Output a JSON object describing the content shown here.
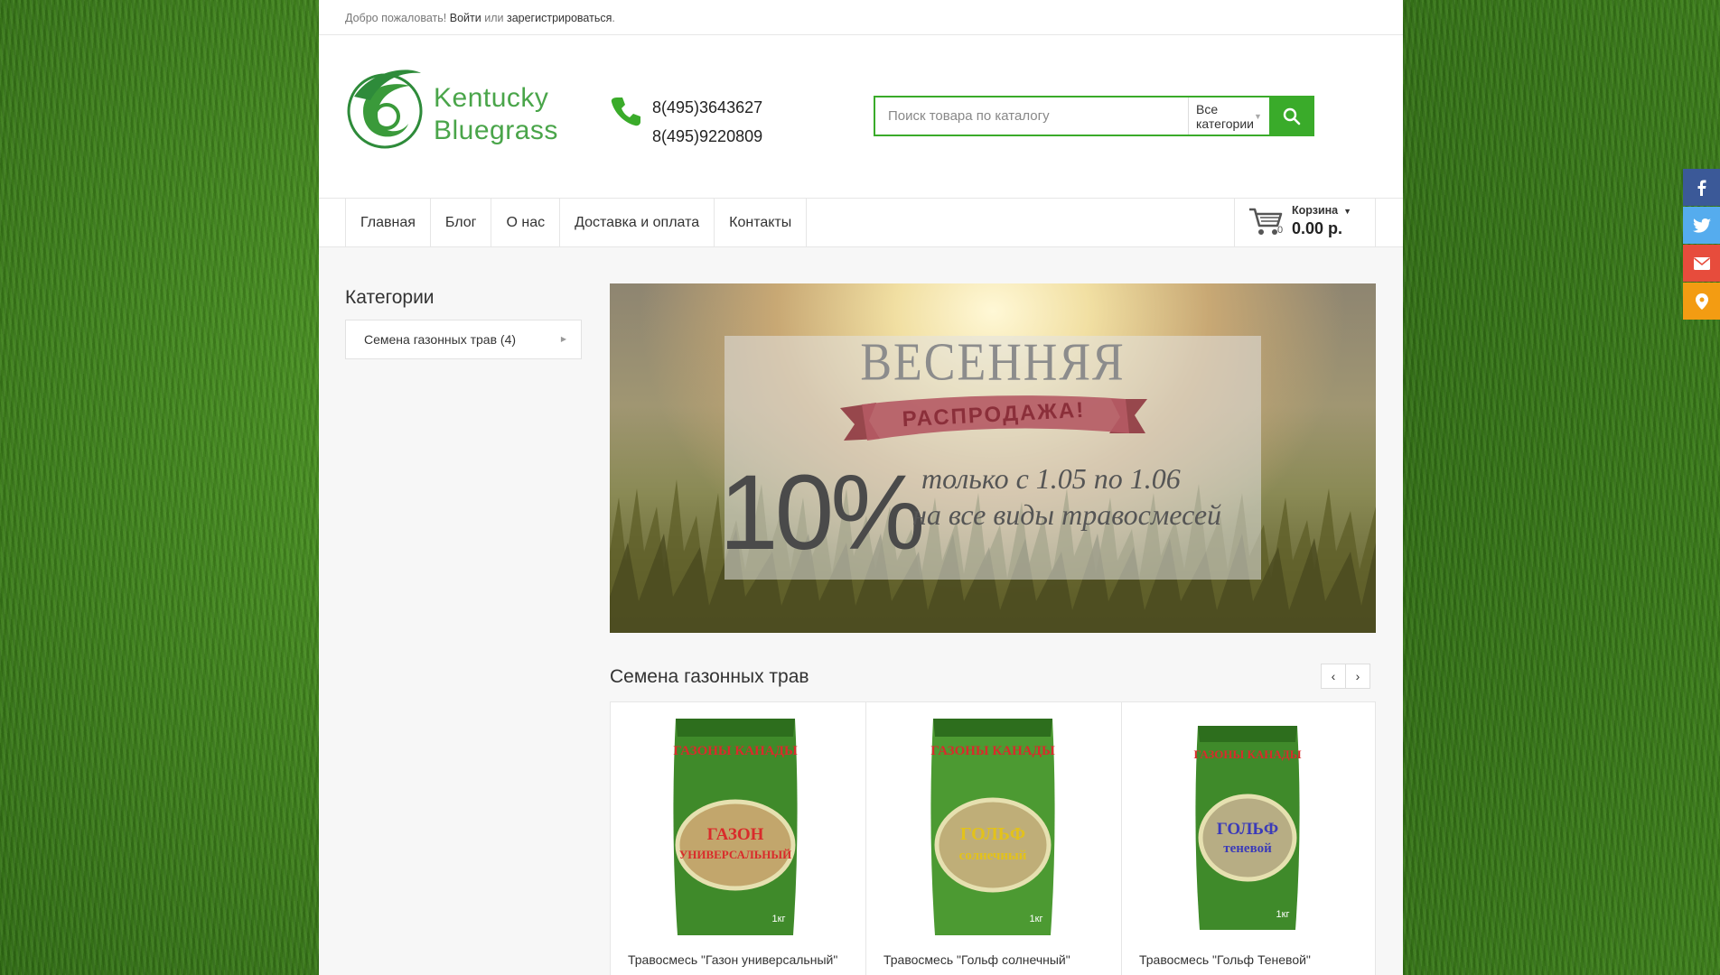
{
  "colors": {
    "accent": "#3aab2a",
    "facebook": "#3b5998",
    "twitter": "#55acee",
    "email": "#e74c3c",
    "location": "#f39c12"
  },
  "topbar": {
    "welcome": "Добро пожаловать!",
    "login": "Войти",
    "or": "или",
    "register": "зарегистрироваться",
    "dot": "."
  },
  "logo": {
    "line1": "Kentucky",
    "line2": "Bluegrass"
  },
  "contacts": {
    "icon": "phone-icon",
    "phone1": "8(495)3643627",
    "phone2": "8(495)9220809"
  },
  "search": {
    "placeholder": "Поиск товара по каталогу",
    "category": "Все категории",
    "icon": "search-icon"
  },
  "nav": {
    "items": [
      "Главная",
      "Блог",
      "О нас",
      "Доставка и оплата",
      "Контакты"
    ]
  },
  "cart": {
    "label": "Корзина",
    "count": "0",
    "total": "0.00 р.",
    "icon": "cart-icon"
  },
  "sidebar": {
    "title": "Категории",
    "categories": [
      "Семена газонных трав (4)"
    ]
  },
  "banner": {
    "line_spring": "ВЕСЕННЯЯ",
    "line_sale": "РАСПРОДАЖА!",
    "percent": "10%",
    "line_dates": "только с 1.05 по 1.06",
    "line_all": "на все виды травосмесей"
  },
  "section": {
    "title": "Семена газонных трав"
  },
  "products": [
    {
      "name": "Травосмесь \"Газон универсальный\"",
      "brand": "ГАЗОНЫ КАНАДЫ",
      "label_top": "ГАЗОН",
      "label_bottom": "УНИВЕРСАЛЬНЫЙ",
      "weight": "1кг"
    },
    {
      "name": "Травосмесь \"Гольф солнечный\"",
      "brand": "ГАЗОНЫ КАНАДЫ",
      "label_top": "ГОЛЬФ",
      "label_bottom": "солнечный",
      "weight": "1кг"
    },
    {
      "name": "Травосмесь \"Гольф Теневой\"",
      "brand": "ГАЗОНЫ КАНАДЫ",
      "label_top": "ГОЛЬФ",
      "label_bottom": "теневой",
      "weight": "1кг"
    }
  ],
  "social": [
    "facebook-icon",
    "twitter-icon",
    "email-icon",
    "location-icon"
  ]
}
